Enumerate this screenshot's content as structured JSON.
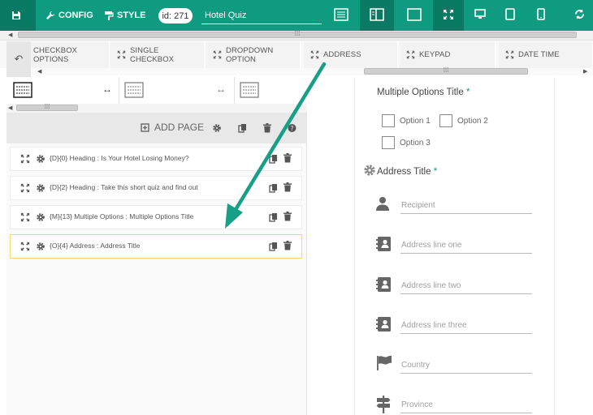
{
  "toolbar": {
    "config_label": "CONFIG",
    "style_label": "STYLE",
    "id_label": "id: 271",
    "quiz_name": "Hotel Quiz"
  },
  "components": [
    {
      "label": "CHECKBOX OPTIONS",
      "icon": "expand-icon"
    },
    {
      "label": "SINGLE CHECKBOX",
      "icon": "expand-icon"
    },
    {
      "label": "DROPDOWN OPTION",
      "icon": "expand-icon"
    },
    {
      "label": "ADDRESS",
      "icon": "expand-icon"
    },
    {
      "label": "KEYPAD",
      "icon": "expand-icon"
    },
    {
      "label": "DATE TIME",
      "icon": "expand-icon"
    }
  ],
  "page_bar": {
    "add_page_label": "ADD PAGE"
  },
  "fields": [
    {
      "label": "{D}{0} Heading : Is Your Hotel Losing Money?"
    },
    {
      "label": "{D}{2} Heading : Take this short quiz and find out"
    },
    {
      "label": "{M}{13} Multiple Options : Multiple Options Title"
    },
    {
      "label": "{O}{4} Address : Address Title"
    }
  ],
  "preview": {
    "multiple_options": {
      "title": "Multiple Options Title",
      "required_mark": "*",
      "options": [
        "Option 1",
        "Option 2",
        "Option 3"
      ]
    },
    "address": {
      "title": "Address Title",
      "required_mark": "*",
      "fields": [
        {
          "placeholder": "Recipient",
          "icon": "person-icon"
        },
        {
          "placeholder": "Address line one",
          "icon": "address-book-icon"
        },
        {
          "placeholder": "Address line two",
          "icon": "address-book-icon"
        },
        {
          "placeholder": "Address line three",
          "icon": "address-book-icon"
        },
        {
          "placeholder": "Country",
          "icon": "flag-icon"
        },
        {
          "placeholder": "Province",
          "icon": "signpost-icon"
        }
      ]
    }
  },
  "colors": {
    "brand": "#0f9b80",
    "brand_dark": "#0b7a64",
    "selected_border": "#f4d86a",
    "annotation_arrow": "#17a085"
  }
}
